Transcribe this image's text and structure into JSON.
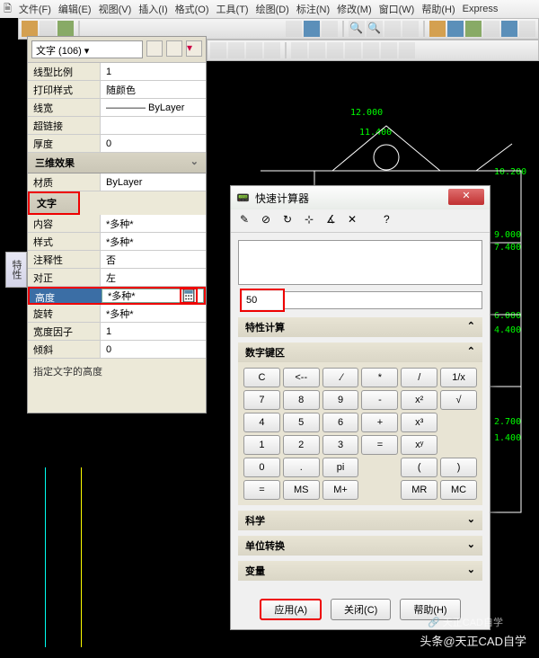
{
  "menu": [
    "文件(F)",
    "编辑(E)",
    "视图(V)",
    "插入(I)",
    "格式(O)",
    "工具(T)",
    "绘图(D)",
    "标注(N)",
    "修改(M)",
    "窗口(W)",
    "帮助(H)",
    "Express"
  ],
  "props": {
    "selector": "文字 (106)",
    "rows1": [
      {
        "label": "线型比例",
        "val": "1"
      },
      {
        "label": "打印样式",
        "val": "随颜色"
      },
      {
        "label": "线宽",
        "val": "———— ByLayer"
      },
      {
        "label": "超链接",
        "val": ""
      },
      {
        "label": "厚度",
        "val": "0"
      }
    ],
    "sec_3d": "三维效果",
    "row_material": {
      "label": "材质",
      "val": "ByLayer"
    },
    "sec_text": "文字",
    "rows_text": [
      {
        "label": "内容",
        "val": "*多种*"
      },
      {
        "label": "样式",
        "val": "*多种*"
      },
      {
        "label": "注释性",
        "val": "否"
      },
      {
        "label": "对正",
        "val": "左"
      }
    ],
    "row_height": {
      "label": "高度",
      "val": "*多种*"
    },
    "rows_after": [
      {
        "label": "旋转",
        "val": "*多种*"
      },
      {
        "label": "宽度因子",
        "val": "1"
      },
      {
        "label": "倾斜",
        "val": "0"
      }
    ],
    "desc": "指定文字的高度"
  },
  "sidetab": "特性",
  "calc": {
    "title": "快速计算器",
    "input": "50",
    "sec_char": "特性计算",
    "sec_keypad": "数字键区",
    "keys": [
      "C",
      "<-",
      "/",
      "*",
      "-",
      "1/x",
      "7",
      "8",
      "9",
      "+",
      "x^2",
      "√",
      "4",
      "5",
      "6",
      "-",
      "x^3",
      "",
      "1",
      "2",
      "3",
      "",
      "x^y",
      "",
      "0",
      ".",
      "pi",
      "",
      "(",
      ")",
      "=",
      "MS",
      "M+",
      "MR",
      "MC"
    ],
    "keyrows": [
      [
        "C",
        "<--",
        ".⁄",
        "*",
        "/",
        "1/x"
      ],
      [
        "7",
        "8",
        "9",
        "-",
        "x²",
        "√"
      ],
      [
        "4",
        "5",
        "6",
        "+",
        "x³",
        ""
      ],
      [
        "1",
        "2",
        "3",
        "=",
        "xʸ",
        ""
      ],
      [
        "0",
        ".",
        "pi",
        "",
        "(",
        ")"
      ],
      [
        "=",
        "MS",
        "M+",
        "",
        "MR",
        "MC"
      ]
    ],
    "sec_sci": "科学",
    "sec_unit": "单位转换",
    "sec_var": "变量",
    "btn_apply": "应用(A)",
    "btn_close": "关闭(C)",
    "btn_help": "帮助(H)"
  },
  "dims": {
    "d1": "12.000",
    "d2": "11.400",
    "d3": "10.200",
    "d4": "9.000",
    "d5": "7.400",
    "d6": "6.000",
    "d7": "4.400",
    "d8": "2.700",
    "d9": "1.400"
  },
  "wm": "头条@天正CAD自学",
  "wm2": "🔗 天正CAD自学"
}
